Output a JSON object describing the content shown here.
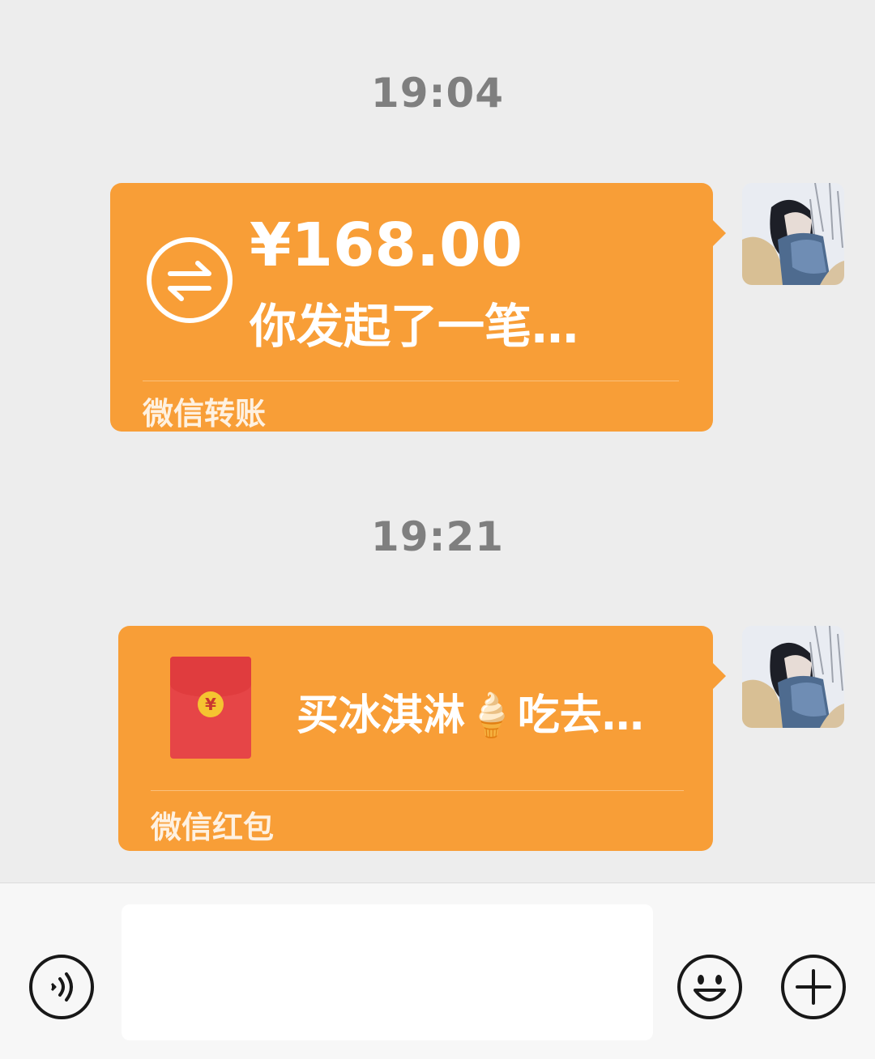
{
  "messages": [
    {
      "timestamp": "19:04",
      "type": "transfer",
      "amount": "¥168.00",
      "description": "你发起了一笔…",
      "footer": "微信转账"
    },
    {
      "timestamp": "19:21",
      "type": "red-packet",
      "text": "买冰淇淋🍦吃去…",
      "footer": "微信红包"
    }
  ],
  "colors": {
    "background": "#ededed",
    "bubble": "#f89e37",
    "envelope": "#e64547",
    "coin": "#f5c431",
    "timestamp": "#7f7f7f"
  },
  "icons": {
    "transfer": "transfer-arrows-icon",
    "red_packet": "red-envelope-icon",
    "voice": "voice-icon",
    "emoji": "emoji-icon",
    "plus": "plus-icon"
  },
  "input": {
    "value": "",
    "placeholder": ""
  }
}
